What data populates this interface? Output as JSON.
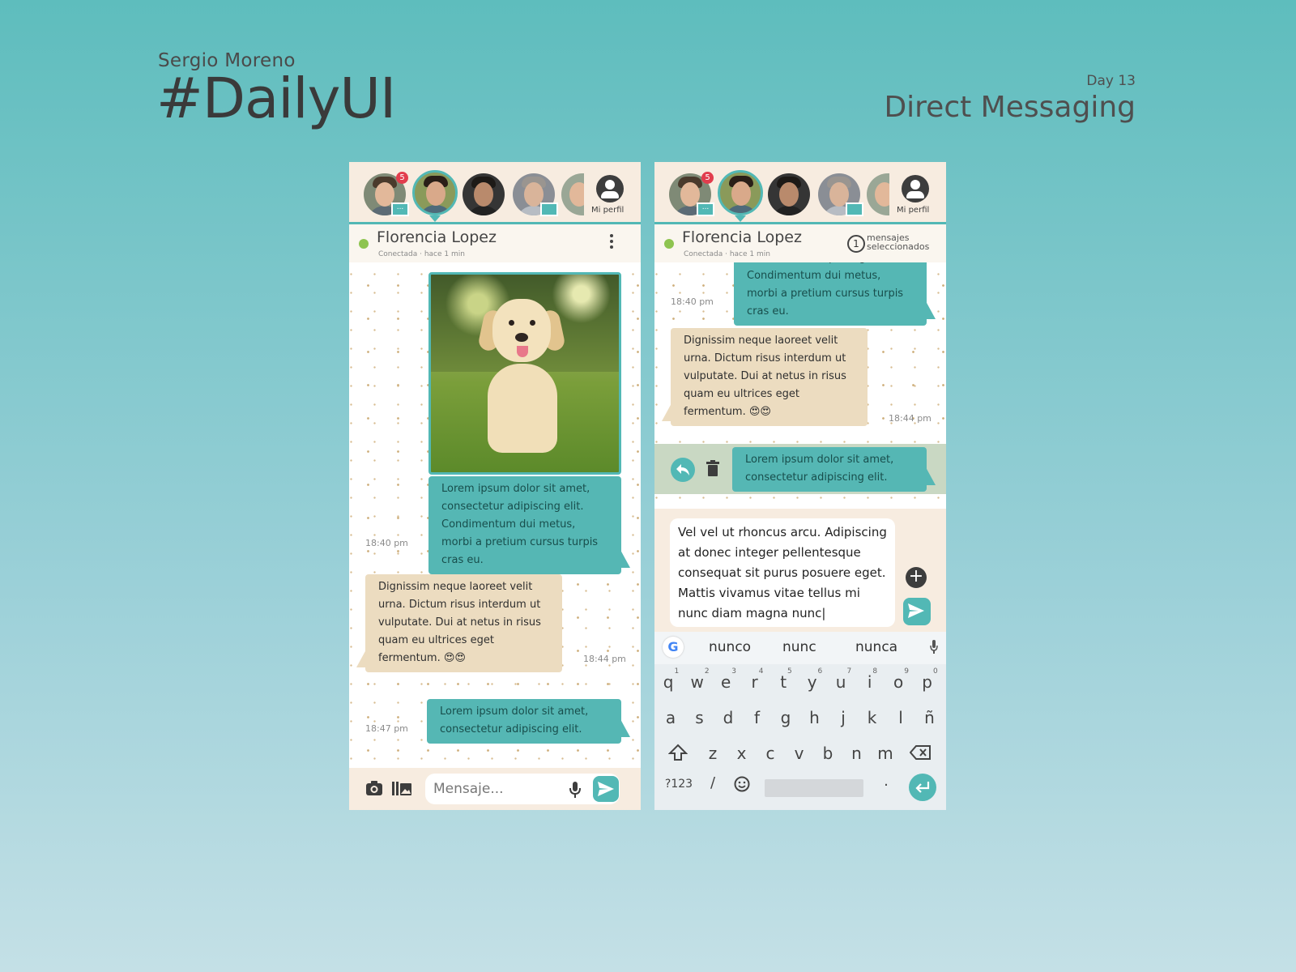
{
  "header": {
    "author": "Sergio Moreno",
    "title": "#DailyUI",
    "day": "Day 13",
    "subtitle": "Direct Messaging"
  },
  "colors": {
    "accent": "#52b8b5",
    "badge": "#e23d4d",
    "online": "#8ec450",
    "incoming_bubble": "#ecdcc0",
    "topbar": "#f7ece0"
  },
  "contacts_bar": {
    "unread_badge": "5",
    "chat_chip": "...",
    "profile_label": "Mi perfil"
  },
  "chat_header": {
    "name": "Florencia Lopez",
    "status": "Conectada · hace 1 min"
  },
  "screen1": {
    "messages": [
      {
        "type": "image",
        "icon": "dog-photo"
      },
      {
        "type": "outgoing",
        "text": "Lorem ipsum dolor sit amet, consectetur adipiscing elit. Condimentum dui metus, morbi a pretium cursus turpis cras eu.",
        "time": "18:40 pm"
      },
      {
        "type": "incoming",
        "text": "Dignissim neque laoreet velit urna. Dictum risus interdum ut vulputate. Dui at netus in risus quam eu ultrices eget fermentum. 😍😍",
        "time": "18:44 pm"
      },
      {
        "type": "outgoing",
        "text": "Lorem ipsum dolor sit amet, consectetur adipiscing elit.",
        "time": "18:47 pm"
      }
    ],
    "input_placeholder": "Mensaje..."
  },
  "screen2": {
    "selection": {
      "count": "1",
      "label_line1": "mensajes",
      "label_line2": "seleccionados"
    },
    "messages": [
      {
        "type": "outgoing",
        "text": "consectetur adipiscing elit. Condimentum dui metus, morbi a pretium cursus turpis cras eu.",
        "time": "18:40 pm"
      },
      {
        "type": "incoming",
        "text": "Dignissim neque laoreet velit urna. Dictum risus interdum ut vulputate. Dui at netus in risus quam eu ultrices eget fermentum. 😍😍",
        "time": "18:44 pm"
      },
      {
        "type": "selected",
        "text": "Lorem ipsum dolor sit amet, consectetur adipiscing elit."
      }
    ],
    "compose_text": "Vel vel ut rhoncus arcu. Adipiscing at donec integer pellentesque consequat sit purus posuere eget. Mattis vivamus vitae tellus mi nunc diam magna nunc|"
  },
  "keyboard": {
    "suggestions": [
      "nunco",
      "nunc",
      "nunca"
    ],
    "row1": [
      "q",
      "w",
      "e",
      "r",
      "t",
      "y",
      "u",
      "i",
      "o",
      "p"
    ],
    "row1_digits": [
      "1",
      "2",
      "3",
      "4",
      "5",
      "6",
      "7",
      "8",
      "9",
      "0"
    ],
    "row2": [
      "a",
      "s",
      "d",
      "f",
      "g",
      "h",
      "j",
      "k",
      "l",
      "ñ"
    ],
    "row3": [
      "z",
      "x",
      "c",
      "v",
      "b",
      "n",
      "m"
    ],
    "symbols_key": "?123",
    "slash_key": "/",
    "period_key": "."
  }
}
